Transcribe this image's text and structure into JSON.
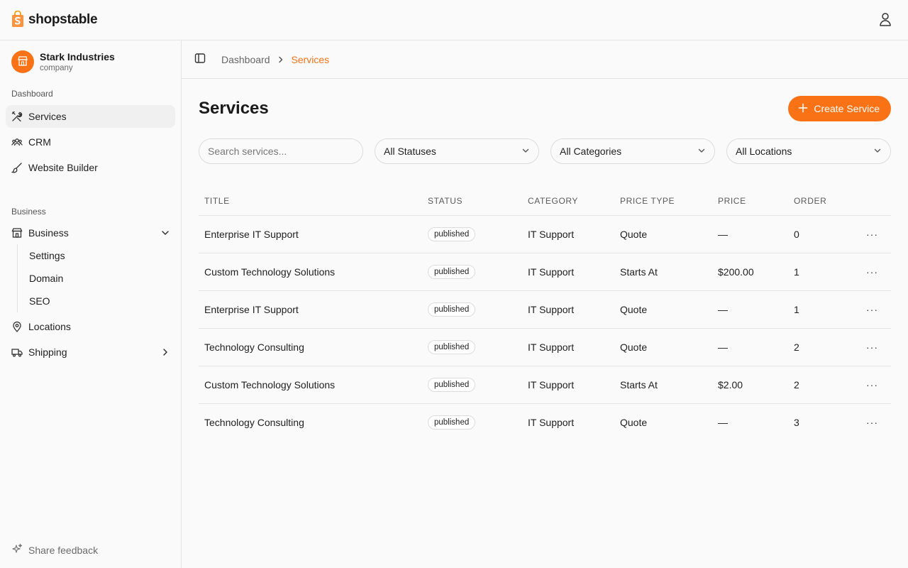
{
  "brand": {
    "name": "shopstable",
    "accent": "#f97316"
  },
  "company": {
    "name": "Stark Industries",
    "type": "company"
  },
  "sidebar": {
    "groups": [
      {
        "label": "Dashboard"
      },
      {
        "label": "Business"
      }
    ],
    "items": [
      {
        "label": "Services",
        "icon": "tools-icon"
      },
      {
        "label": "CRM",
        "icon": "users-icon"
      },
      {
        "label": "Website Builder",
        "icon": "brush-icon"
      },
      {
        "label": "Business",
        "icon": "store-icon"
      },
      {
        "label": "Locations",
        "icon": "map-pin-icon"
      },
      {
        "label": "Shipping",
        "icon": "truck-icon"
      }
    ],
    "business_sub": [
      "Settings",
      "Domain",
      "SEO"
    ],
    "feedback": "Share feedback"
  },
  "breadcrumb": {
    "parent": "Dashboard",
    "current": "Services"
  },
  "page": {
    "title": "Services",
    "create_button": "Create Service"
  },
  "filters": {
    "search_placeholder": "Search services...",
    "status": "All Statuses",
    "category": "All Categories",
    "location": "All Locations"
  },
  "table": {
    "columns": [
      "TITLE",
      "STATUS",
      "CATEGORY",
      "PRICE TYPE",
      "PRICE",
      "ORDER"
    ],
    "rows": [
      {
        "title": "Enterprise IT Support",
        "status": "published",
        "category": "IT Support",
        "price_type": "Quote",
        "price": "—",
        "order": "0"
      },
      {
        "title": "Custom Technology Solutions",
        "status": "published",
        "category": "IT Support",
        "price_type": "Starts At",
        "price": "$200.00",
        "order": "1"
      },
      {
        "title": "Enterprise IT Support",
        "status": "published",
        "category": "IT Support",
        "price_type": "Quote",
        "price": "—",
        "order": "1"
      },
      {
        "title": "Technology Consulting",
        "status": "published",
        "category": "IT Support",
        "price_type": "Quote",
        "price": "—",
        "order": "2"
      },
      {
        "title": "Custom Technology Solutions",
        "status": "published",
        "category": "IT Support",
        "price_type": "Starts At",
        "price": "$2.00",
        "order": "2"
      },
      {
        "title": "Technology Consulting",
        "status": "published",
        "category": "IT Support",
        "price_type": "Quote",
        "price": "—",
        "order": "3"
      }
    ],
    "row_action": "···"
  }
}
